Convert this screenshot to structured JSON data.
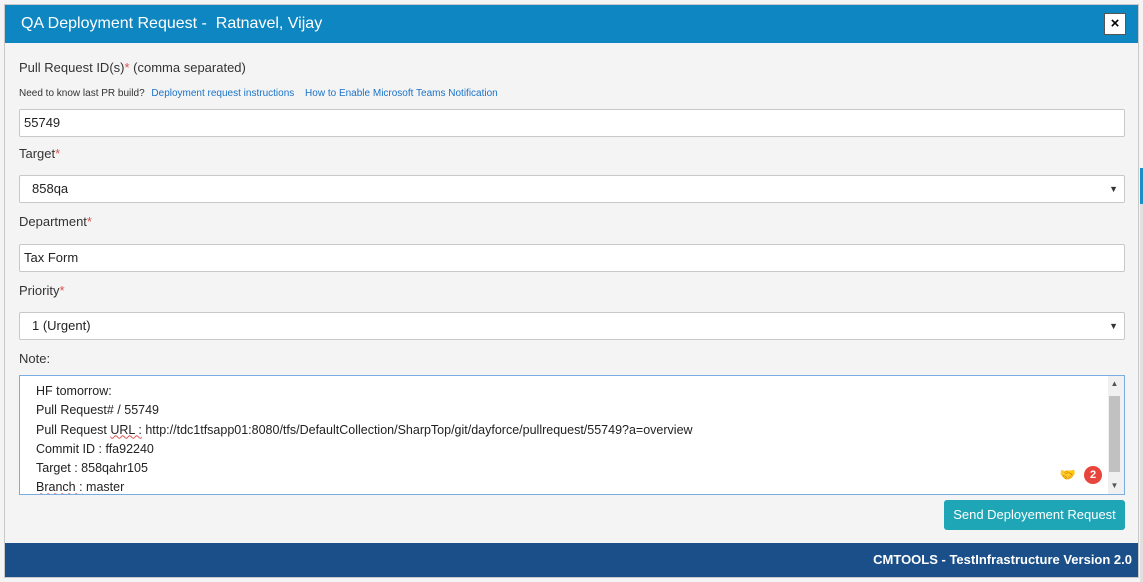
{
  "dialog": {
    "title": "QA Deployment Request -  Ratnavel, Vijay",
    "close_label": "×"
  },
  "form": {
    "pull_request": {
      "label": "Pull Request ID(s)",
      "required_mark": "*",
      "hint": " (comma separated)",
      "help_prefix": "Need to know last PR build?",
      "help_links": [
        "Deployment request instructions",
        "How to Enable Microsoft Teams Notification"
      ],
      "value": "55749"
    },
    "target": {
      "label": "Target",
      "required_mark": "*",
      "value": "858qa"
    },
    "department": {
      "label": "Department",
      "required_mark": "*",
      "value": "Tax Form"
    },
    "priority": {
      "label": "Priority",
      "required_mark": "*",
      "value": "1 (Urgent)"
    },
    "note": {
      "label": "Note:",
      "lines": [
        "HF tomorrow:",
        "Pull Request# / 55749",
        [
          "Pull Request ",
          "URL :",
          " http://tdc1tfsapp01:8080/tfs/DefaultCollection/SharpTop/git/dayforce/pullrequest/55749?a=overview"
        ],
        "Commit ID : ffa92240",
        "Target : 858qahr105",
        [
          "",
          "Branch :",
          " master"
        ]
      ],
      "extension_badge": "2"
    },
    "submit_label": "Send Deployement Request"
  },
  "footer": {
    "text": "CMTOOLS - TestInfrastructure Version 2.0"
  },
  "colors": {
    "header": "#0e86c1",
    "footer": "#1a4f8a",
    "submit": "#1ea5b6",
    "required": "#d9534f",
    "link": "#1a73c9"
  }
}
